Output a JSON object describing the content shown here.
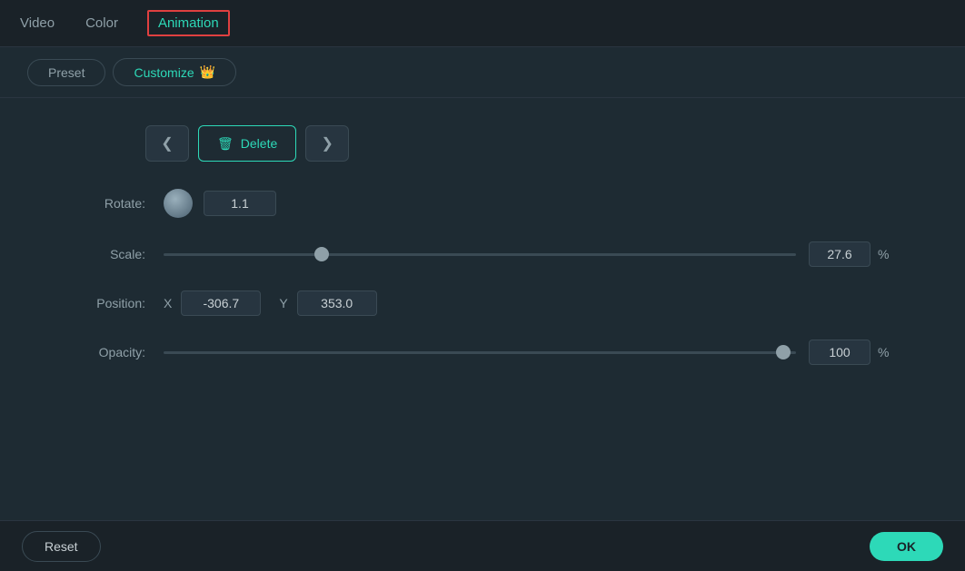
{
  "topNav": {
    "tabs": [
      {
        "id": "video",
        "label": "Video",
        "active": false
      },
      {
        "id": "color",
        "label": "Color",
        "active": false
      },
      {
        "id": "animation",
        "label": "Animation",
        "active": true
      }
    ]
  },
  "subNav": {
    "preset": "Preset",
    "customize": "Customize",
    "crownEmoji": "👑"
  },
  "buttons": {
    "prev": "❮",
    "delete": "Delete",
    "trashIcon": "🗑",
    "next": "❯"
  },
  "controls": {
    "rotate": {
      "label": "Rotate:",
      "value": "1.1"
    },
    "scale": {
      "label": "Scale:",
      "value": "27.6",
      "unit": "%",
      "thumbPercent": 25
    },
    "position": {
      "label": "Position:",
      "xLabel": "X",
      "xValue": "-306.7",
      "yLabel": "Y",
      "yValue": "353.0"
    },
    "opacity": {
      "label": "Opacity:",
      "value": "100",
      "unit": "%",
      "thumbPercent": 98
    }
  },
  "footer": {
    "resetLabel": "Reset",
    "okLabel": "OK"
  },
  "colors": {
    "accent": "#2dd9b8",
    "border": "#3a4a54",
    "bg": "#1e2b33",
    "navBg": "#1a2228",
    "inputBg": "#273540"
  }
}
